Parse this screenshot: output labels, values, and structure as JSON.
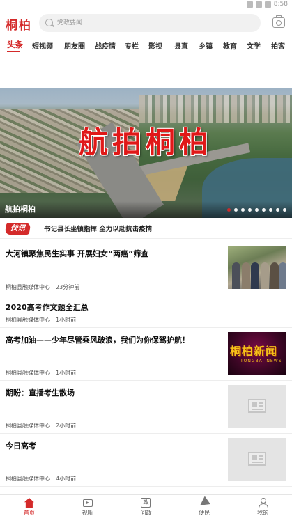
{
  "status_bar": {
    "time": "8:58"
  },
  "header": {
    "logo": "桐柏",
    "search_placeholder": "党政要闻"
  },
  "tabs": [
    {
      "label": "头条",
      "active": true
    },
    {
      "label": "短视频"
    },
    {
      "label": "朋友圈"
    },
    {
      "label": "战疫情"
    },
    {
      "label": "专栏"
    },
    {
      "label": "影视"
    },
    {
      "label": "县直"
    },
    {
      "label": "乡镇"
    },
    {
      "label": "教育"
    },
    {
      "label": "文学"
    },
    {
      "label": "拍客"
    }
  ],
  "banner": {
    "overlay_title": "航拍桐柏",
    "caption": "航拍桐柏",
    "dot_count": 9,
    "active_dot": 0
  },
  "flash": {
    "badge": "快讯",
    "text": "书记县长坐镇指挥 全力以赴抗击疫情"
  },
  "news": [
    {
      "title": "大河镇聚焦民生实事  开展妇女“两癌”筛查",
      "source": "桐柏县融媒体中心",
      "time": "23分钟前",
      "thumb": "photo"
    },
    {
      "title": "2020高考作文题全汇总",
      "source": "桐柏县融媒体中心",
      "time": "1小时前",
      "thumb": "none"
    },
    {
      "title": "高考加油——少年尽管乘风破浪，我们为你保驾护航！",
      "source": "桐柏县融媒体中心",
      "time": "1小时前",
      "thumb": "brand",
      "thumb_text": "桐柏新闻",
      "thumb_subtext": "TONGBAI NEWS"
    },
    {
      "title": "期盼：直播考生散场",
      "source": "桐柏县融媒体中心",
      "time": "2小时前",
      "thumb": "placeholder"
    },
    {
      "title": "今日高考",
      "source": "桐柏县融媒体中心",
      "time": "4小时前",
      "thumb": "placeholder"
    }
  ],
  "bottom_nav": [
    {
      "label": "首页",
      "icon": "home-icon",
      "active": true
    },
    {
      "label": "视听",
      "icon": "tv-icon"
    },
    {
      "label": "问政",
      "icon": "gov-icon",
      "glyph": "政"
    },
    {
      "label": "便民",
      "icon": "send-icon"
    },
    {
      "label": "我的",
      "icon": "user-icon"
    }
  ],
  "colors": {
    "accent": "#d42a2a"
  }
}
